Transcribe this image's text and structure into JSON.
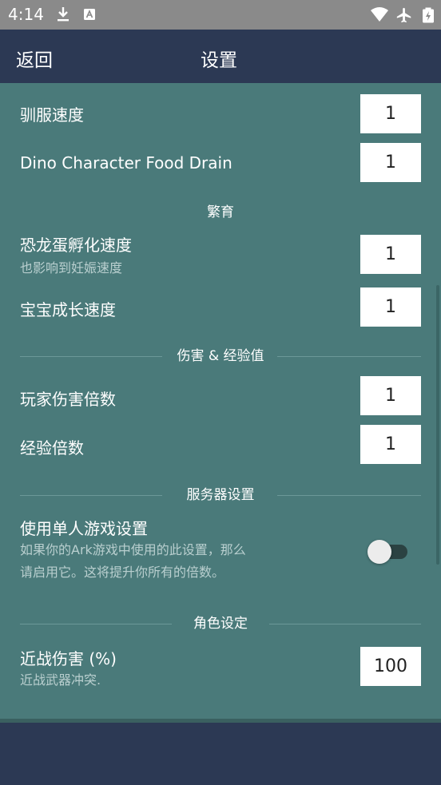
{
  "status_bar": {
    "time": "4:14"
  },
  "app_bar": {
    "back_label": "返回",
    "title": "设置"
  },
  "settings": {
    "taming_speed": {
      "label": "驯服速度",
      "value": "1"
    },
    "food_drain": {
      "label": "Dino Character Food Drain",
      "value": "1"
    },
    "breeding_header": "繁育",
    "egg_hatch": {
      "label": "恐龙蛋孵化速度",
      "subtitle": "也影响到妊娠速度",
      "value": "1"
    },
    "baby_growth": {
      "label": "宝宝成长速度",
      "value": "1"
    },
    "damage_header": "伤害 & 经验值",
    "player_damage": {
      "label": "玩家伤害倍数",
      "value": "1"
    },
    "xp_multiplier": {
      "label": "经验倍数",
      "value": "1"
    },
    "server_header": "服务器设置",
    "single_player": {
      "label": "使用单人游戏设置",
      "subtitle_line1": "如果你的Ark游戏中使用的此设置，那么",
      "subtitle_line2": "请启用它。这将提升你所有的倍数。",
      "enabled": false
    },
    "character_header": "角色设定",
    "melee_damage": {
      "label": "近战伤害 (%)",
      "subtitle": "近战武器冲突.",
      "value": "100"
    }
  }
}
